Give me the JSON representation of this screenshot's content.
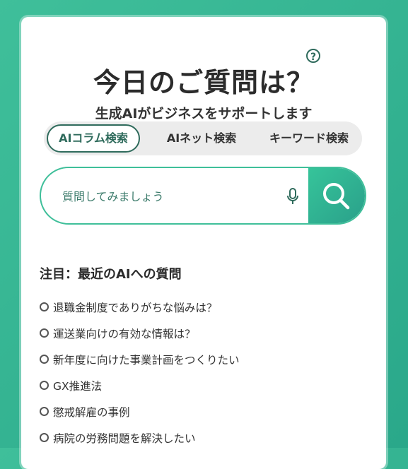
{
  "header": {
    "title": "今日のご質問は？",
    "help_icon_glyph": "?",
    "subtitle": "生成AIがビジネスをサポートします"
  },
  "tabs": [
    {
      "label": "AIコラム検索",
      "active": true
    },
    {
      "label": "AIネット検索",
      "active": false
    },
    {
      "label": "キーワード検索",
      "active": false
    }
  ],
  "search": {
    "placeholder": "質問してみましょう",
    "value": "",
    "icons": {
      "mic": "microphone-icon",
      "submit": "search-icon"
    }
  },
  "featured": {
    "title": "注目：最近のAIへの質問",
    "items": [
      "退職金制度でありがちな悩みは？",
      "運送業向けの有効な情報は？",
      "新年度に向けた事業計画をつくりたい",
      "GX推進法",
      "懲戒解雇の事例",
      "病院の労務問題を解決したい"
    ]
  },
  "colors": {
    "background": "#3fbf9a",
    "accent": "#2f6b5c",
    "search_button": "#36c49a"
  }
}
